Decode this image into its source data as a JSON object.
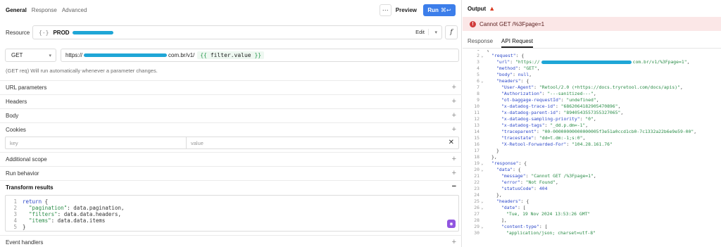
{
  "tabs": [
    "General",
    "Response",
    "Advanced"
  ],
  "toolbar": {
    "more": "···",
    "preview": "Preview",
    "run": "Run",
    "run_shortcut": "⌘↩"
  },
  "resource": {
    "label": "Resource",
    "icon": "database-icon",
    "name": "PROD",
    "edit": "Edit",
    "fx": "f"
  },
  "request": {
    "method": "GET",
    "url_prefix": "https://",
    "url_suffix": "com.br/v1/",
    "template_open": "{{",
    "template_var": "filter.value",
    "template_close": "}}",
    "hint": "(GET req) Will run automatically whenever a parameter changes."
  },
  "sections": {
    "url_params": "URL parameters",
    "headers": "Headers",
    "body": "Body",
    "cookies": "Cookies",
    "additional_scope": "Additional scope",
    "run_behavior": "Run behavior",
    "transform": "Transform results",
    "event_handlers": "Event handlers"
  },
  "cookies": {
    "key_placeholder": "key",
    "value_placeholder": "value"
  },
  "transform_code": [
    {
      "n": "1",
      "kw": "return",
      "rest": " {"
    },
    {
      "n": "2",
      "key": "\"pagination\"",
      "rest": ": data.pagination,"
    },
    {
      "n": "3",
      "key": "\"filters\"",
      "rest": ": data.data.headers,"
    },
    {
      "n": "4",
      "key": "\"items\"",
      "rest": ": data.data.items"
    },
    {
      "n": "5",
      "rest": "}"
    }
  ],
  "output": {
    "title": "Output",
    "error": "Cannot GET /%3Fpage=1",
    "tabs": [
      "Response",
      "API Request"
    ],
    "lines": [
      {
        "n": "1",
        "code": "{"
      },
      {
        "n": "2",
        "fold": true,
        "key": "\"request\"",
        "rest": ": {"
      },
      {
        "n": "3",
        "key": "\"url\"",
        "rest": ": ",
        "str": "\"https://",
        "str2": "com.br/v1/%3Fpage=1\"",
        "redacted": true,
        "tail": ","
      },
      {
        "n": "4",
        "key": "\"method\"",
        "rest": ": ",
        "str": "\"GET\"",
        "tail": ","
      },
      {
        "n": "5",
        "key": "\"body\"",
        "rest": ": ",
        "num": "null",
        "tail": ","
      },
      {
        "n": "6",
        "fold": true,
        "key": "\"headers\"",
        "rest": ": {"
      },
      {
        "n": "7",
        "key": "\"User-Agent\"",
        "rest": ": ",
        "str": "\"Retool/2.0 (+https://docs.tryretool.com/docs/apis)\"",
        "tail": ","
      },
      {
        "n": "8",
        "key": "\"Authorization\"",
        "rest": ": ",
        "str": "\"---sanitized---\"",
        "tail": ","
      },
      {
        "n": "9",
        "key": "\"ot-baggage-requestId\"",
        "rest": ": ",
        "str": "\"undefined\"",
        "tail": ","
      },
      {
        "n": "10",
        "key": "\"x-datadog-trace-id\"",
        "rest": ": ",
        "str": "\"6862064182905470896\"",
        "tail": ","
      },
      {
        "n": "11",
        "key": "\"x-datadog-parent-id\"",
        "rest": ": ",
        "str": "\"8940543557355327065\"",
        "tail": ","
      },
      {
        "n": "12",
        "key": "\"x-datadog-sampling-priority\"",
        "rest": ": ",
        "str": "\"0\"",
        "tail": ","
      },
      {
        "n": "13",
        "key": "\"x-datadog-tags\"",
        "rest": ": ",
        "str": "\"_dd.p.dm=-1\"",
        "tail": ","
      },
      {
        "n": "14",
        "key": "\"traceparent\"",
        "rest": ": ",
        "str": "\"00-00000000000000005f3e51a0ccd1cb0-7c1332a22b6e9e59-00\"",
        "tail": ","
      },
      {
        "n": "15",
        "key": "\"tracestate\"",
        "rest": ": ",
        "str": "\"dd=t.dm:-1;s:0\"",
        "tail": ","
      },
      {
        "n": "16",
        "key": "\"X-Retool-Forwarded-For\"",
        "rest": ": ",
        "str": "\"104.28.161.76\""
      },
      {
        "n": "17",
        "code": "}"
      },
      {
        "n": "18",
        "code": "},"
      },
      {
        "n": "19",
        "fold": true,
        "key": "\"response\"",
        "rest": ": {"
      },
      {
        "n": "20",
        "fold": true,
        "key": "\"data\"",
        "rest": ": {"
      },
      {
        "n": "21",
        "key": "\"message\"",
        "rest": ": ",
        "str": "\"Cannot GET /%3Fpage=1\"",
        "tail": ","
      },
      {
        "n": "22",
        "key": "\"error\"",
        "rest": ": ",
        "str": "\"Not Found\"",
        "tail": ","
      },
      {
        "n": "23",
        "key": "\"statusCode\"",
        "rest": ": ",
        "num": "404"
      },
      {
        "n": "24",
        "code": "},"
      },
      {
        "n": "25",
        "fold": true,
        "key": "\"headers\"",
        "rest": ": {"
      },
      {
        "n": "26",
        "fold": true,
        "key": "\"date\"",
        "rest": ": ["
      },
      {
        "n": "27",
        "str": "\"Tue, 19 Nov 2024 13:53:26 GMT\""
      },
      {
        "n": "28",
        "code": "],"
      },
      {
        "n": "29",
        "fold": true,
        "key": "\"content-type\"",
        "rest": ": ["
      },
      {
        "n": "30",
        "str": "\"application/json; charset=utf-8\""
      }
    ]
  }
}
